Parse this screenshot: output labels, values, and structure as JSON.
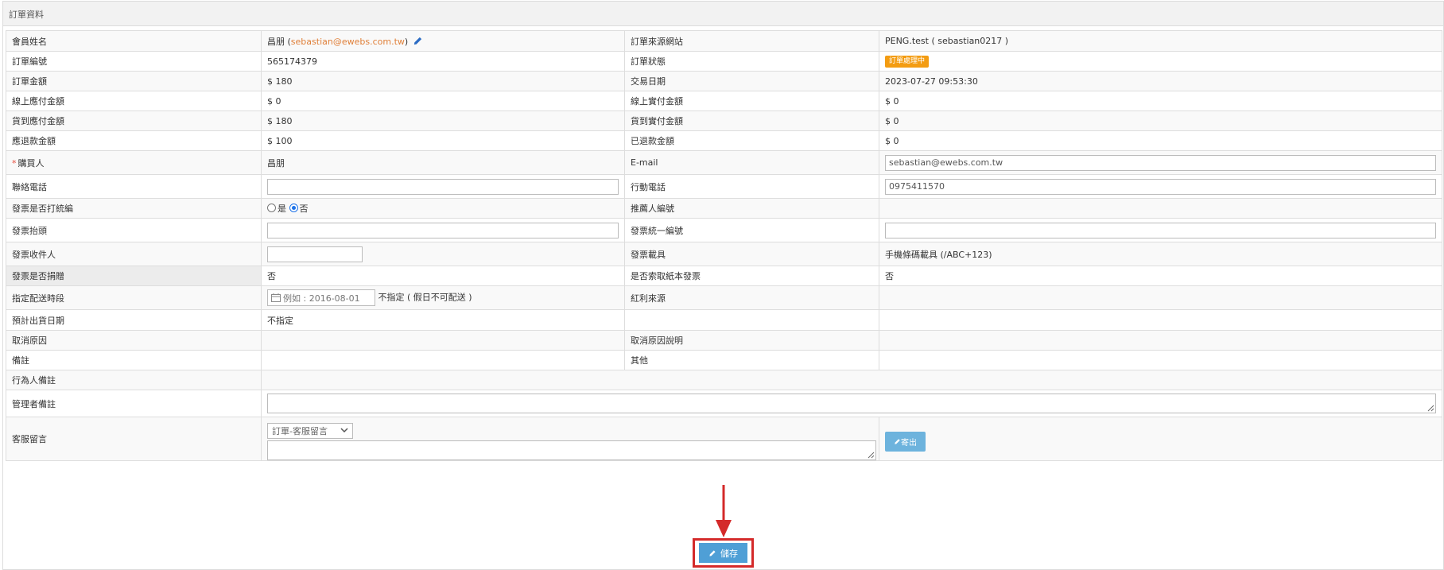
{
  "panel": {
    "title": "訂單資料"
  },
  "rows": {
    "member_label": "會員姓名",
    "member_name": "昌朋",
    "member_email": "sebastian@ewebs.com.tw",
    "source_label": "訂單來源網站",
    "source_value": "PENG.test ( sebastian0217 )",
    "order_no_label": "訂單編號",
    "order_no": "565174379",
    "status_label": "訂單狀態",
    "status_value": "訂單處理中",
    "amount_label": "訂單金額",
    "amount_value": "$ 180",
    "date_label": "交易日期",
    "date_value": "2023-07-27 09:53:30",
    "online_due_label": "線上應付金額",
    "online_due_value": "$ 0",
    "online_paid_label": "線上實付金額",
    "online_paid_value": "$ 0",
    "cod_due_label": "貨到應付金額",
    "cod_due_value": "$ 180",
    "cod_paid_label": "貨到實付金額",
    "cod_paid_value": "$ 0",
    "refund_due_label": "應退款金額",
    "refund_due_value": "$ 100",
    "refunded_label": "已退款金額",
    "refunded_value": "$ 0",
    "buyer_label": "購買人",
    "buyer_value": "昌朋",
    "email_label": "E-mail",
    "email_value": "sebastian@ewebs.com.tw",
    "phone_label": "聯絡電話",
    "phone_value": "",
    "mobile_label": "行動電話",
    "mobile_value": "0975411570",
    "invoice_taxid_label": "發票是否打統編",
    "radio_yes": "是",
    "radio_no": "否",
    "referrer_label": "推薦人編號",
    "invoice_title_label": "發票抬頭",
    "invoice_title_value": "",
    "invoice_uniform_label": "發票統一編號",
    "invoice_uniform_value": "",
    "invoice_recipient_label": "發票收件人",
    "invoice_recipient_value": "",
    "invoice_carrier_label": "發票載具",
    "invoice_carrier_value": "手機條碼載具 (/ABC+123)",
    "invoice_donate_label": "發票是否捐贈",
    "invoice_donate_value": "否",
    "paper_invoice_label": "是否索取紙本發票",
    "paper_invoice_value": "否",
    "delivery_label": "指定配送時段",
    "delivery_placeholder": "例如 : 2016-08-01",
    "delivery_note": "不指定 ( 假日不可配送 )",
    "bonus_label": "紅利來源",
    "ship_date_label": "預計出貨日期",
    "ship_date_value": "不指定",
    "cancel_reason_label": "取消原因",
    "cancel_desc_label": "取消原因說明",
    "note_label": "備註",
    "other_label": "其他",
    "actor_note_label": "行為人備註",
    "admin_note_label": "管理者備註",
    "cs_label": "客服留言",
    "cs_select": "訂單-客服留言",
    "send_label": "寄出"
  },
  "save_label": "儲存"
}
